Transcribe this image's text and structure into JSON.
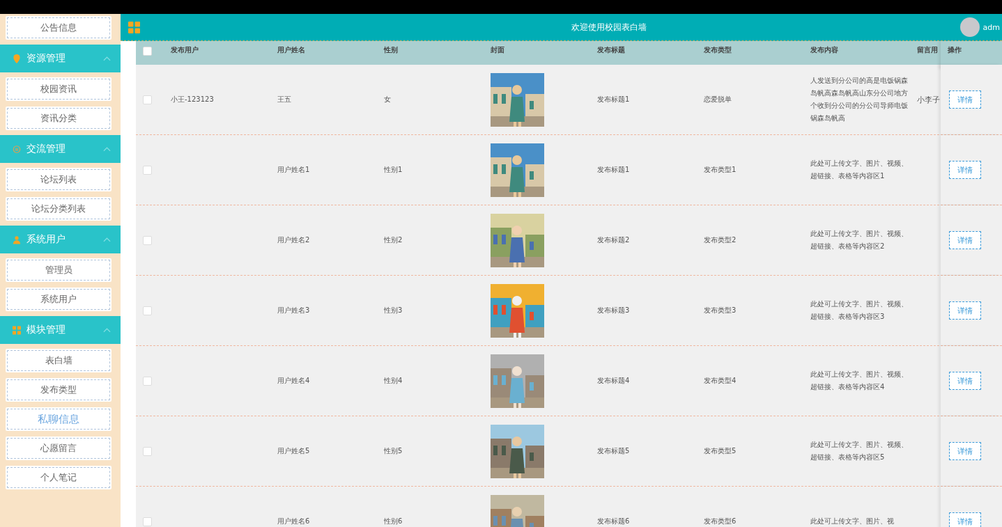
{
  "sidebar": {
    "top_item": {
      "label": "公告信息",
      "selected": false
    },
    "groups": [
      {
        "title": "资源管理",
        "expanded": true,
        "items": [
          {
            "label": "校园资讯",
            "selected": false
          },
          {
            "label": "资讯分类",
            "selected": false
          }
        ]
      },
      {
        "title": "交流管理",
        "expanded": true,
        "items": [
          {
            "label": "论坛列表",
            "selected": false
          },
          {
            "label": "论坛分类列表",
            "selected": false
          }
        ]
      },
      {
        "title": "系统用户",
        "expanded": true,
        "items": [
          {
            "label": "管理员",
            "selected": false
          },
          {
            "label": "系统用户",
            "selected": false
          }
        ]
      },
      {
        "title": "模块管理",
        "expanded": true,
        "items": [
          {
            "label": "表白墙",
            "selected": false
          },
          {
            "label": "发布类型",
            "selected": false
          },
          {
            "label": "私聊信息",
            "selected": true
          },
          {
            "label": "心愿留言",
            "selected": false
          },
          {
            "label": "个人笔记",
            "selected": false
          }
        ]
      }
    ]
  },
  "header": {
    "title": "欢迎使用校园表白墙",
    "user": "adm"
  },
  "table": {
    "select_all": {
      "checked": false
    },
    "columns": [
      "发布用户",
      "用户姓名",
      "性别",
      "封面",
      "发布标题",
      "发布类型",
      "发布内容",
      "留言用",
      "操作"
    ],
    "rows": [
      {
        "checked": false,
        "cells": [
          "小王-123123",
          "王五",
          "女",
          "",
          "发布标题1",
          "恋爱脱单",
          "人发送到分公司的高是电饭锅森岛帆高森岛帆高山东分公司地方个收到分公司的分公司导师电饭锅森岛帆高",
          "小李子"
        ],
        "action": "详情"
      },
      {
        "checked": false,
        "cells": [
          "",
          "用户姓名1",
          "性别1",
          "",
          "发布标题1",
          "发布类型1",
          "此处可上传文字、图片、视频、超链接、表格等内容区1",
          ""
        ],
        "action": "详情"
      },
      {
        "checked": false,
        "cells": [
          "",
          "用户姓名2",
          "性别2",
          "",
          "发布标题2",
          "发布类型2",
          "此处可上传文字、图片、视频、超链接、表格等内容区2",
          ""
        ],
        "action": "详情"
      },
      {
        "checked": false,
        "cells": [
          "",
          "用户姓名3",
          "性别3",
          "",
          "发布标题3",
          "发布类型3",
          "此处可上传文字、图片、视频、超链接、表格等内容区3",
          ""
        ],
        "action": "详情"
      },
      {
        "checked": false,
        "cells": [
          "",
          "用户姓名4",
          "性别4",
          "",
          "发布标题4",
          "发布类型4",
          "此处可上传文字、图片、视频、超链接、表格等内容区4",
          ""
        ],
        "action": "详情"
      },
      {
        "checked": false,
        "cells": [
          "",
          "用户姓名5",
          "性别5",
          "",
          "发布标题5",
          "发布类型5",
          "此处可上传文字、图片、视频、超链接、表格等内容区5",
          ""
        ],
        "action": "详情"
      },
      {
        "checked": false,
        "cells": [
          "",
          "用户姓名6",
          "性别6",
          "",
          "发布标题6",
          "发布类型6",
          "此处可上传文字、图片、视",
          ""
        ],
        "action": "详情"
      }
    ]
  }
}
